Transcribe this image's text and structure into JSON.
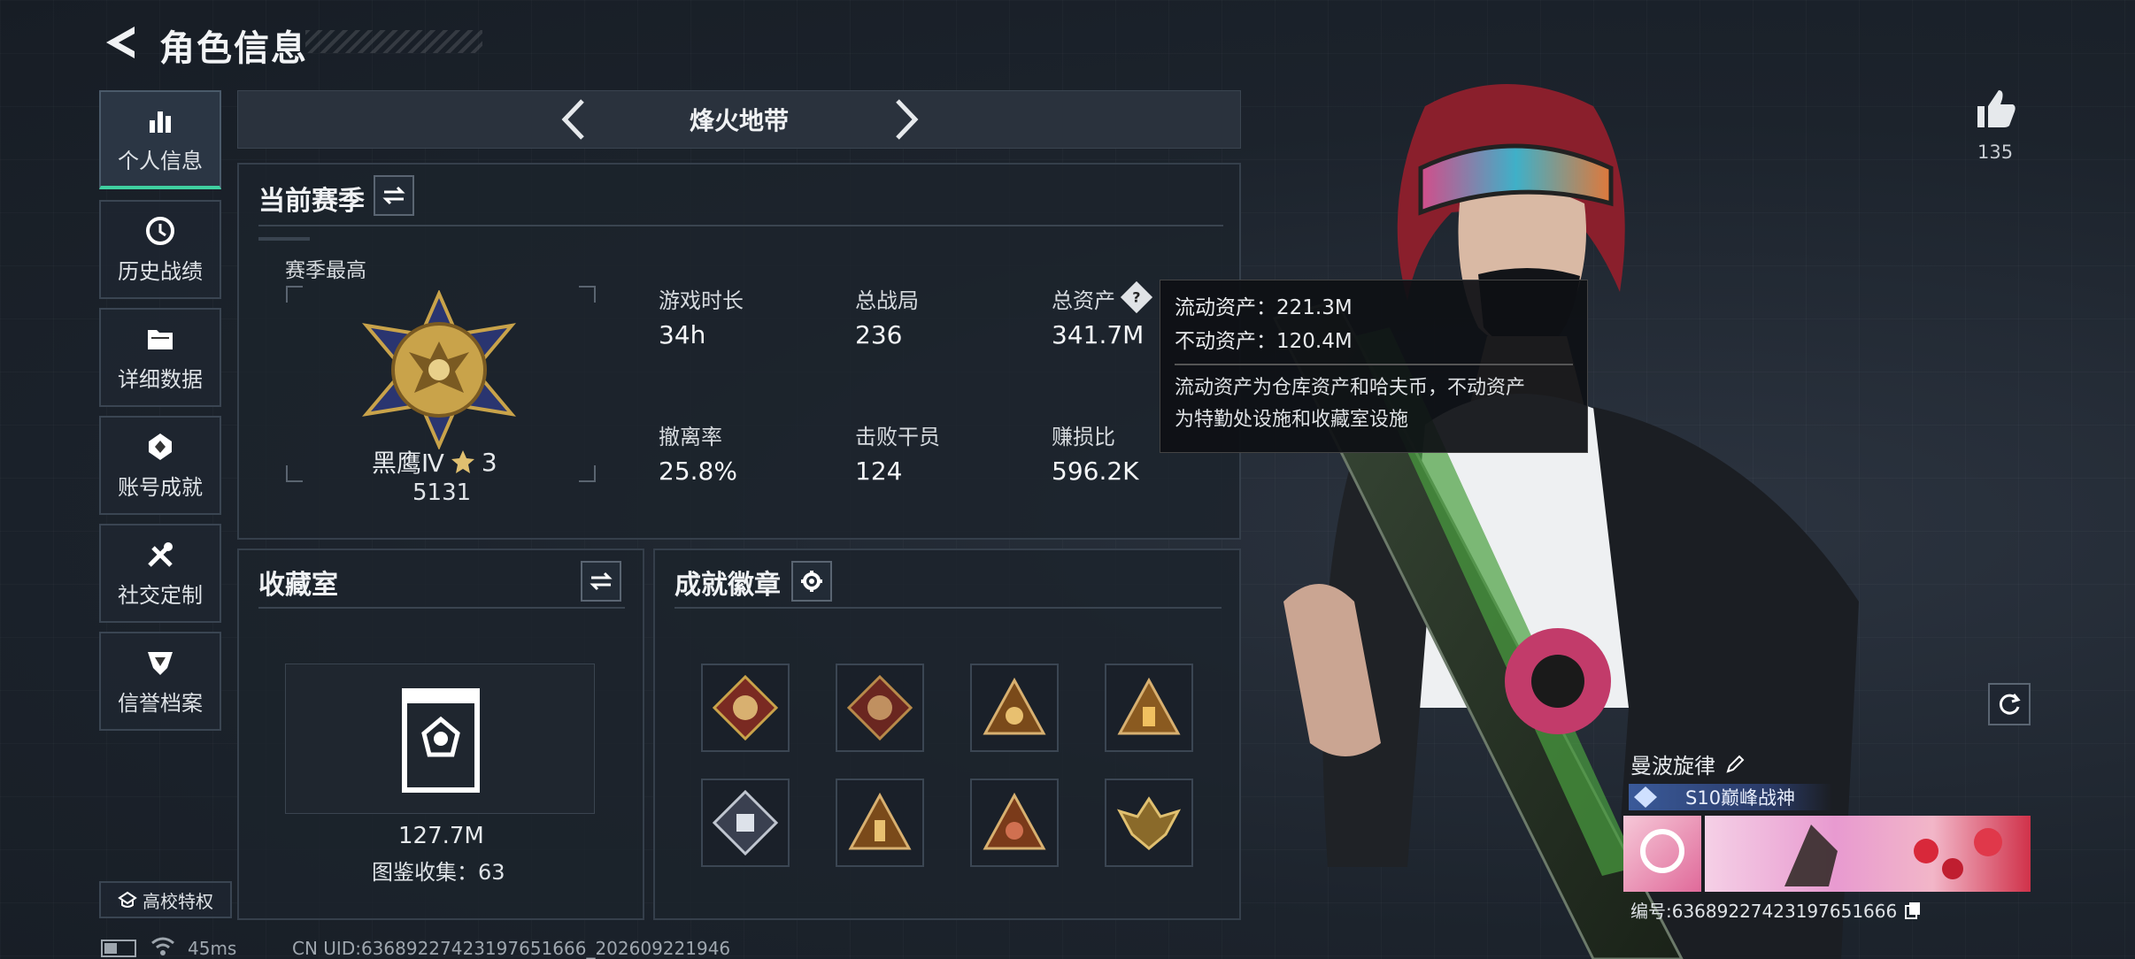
{
  "header": {
    "title": "角色信息"
  },
  "nav": [
    {
      "label": "个人信息",
      "icon": "bar-chart-icon",
      "active": true
    },
    {
      "label": "历史战绩",
      "icon": "clock-icon"
    },
    {
      "label": "详细数据",
      "icon": "folder-icon"
    },
    {
      "label": "账号成就",
      "icon": "achievement-icon"
    },
    {
      "label": "社交定制",
      "icon": "tools-icon"
    },
    {
      "label": "信誉档案",
      "icon": "shield-icon"
    }
  ],
  "campus": {
    "label": "高校特权"
  },
  "mode": {
    "label": "烽火地带"
  },
  "season": {
    "title": "当前赛季",
    "best_label": "赛季最高",
    "rank": "黑鹰Ⅳ",
    "stars": "3",
    "score": "5131",
    "stats": [
      {
        "label": "游戏时长",
        "value": "34h"
      },
      {
        "label": "总战局",
        "value": "236"
      },
      {
        "label": "总资产",
        "value": "341.7M"
      },
      {
        "label": "撤离率",
        "value": "25.8%"
      },
      {
        "label": "击败干员",
        "value": "124"
      },
      {
        "label": "赚损比",
        "value": "596.2K"
      }
    ]
  },
  "tooltip": {
    "liquid": "流动资产：221.3M",
    "fixed": "不动资产：120.4M",
    "desc1": "流动资产为仓库资产和哈夫币，不动资产",
    "desc2": "为特勤处设施和收藏室设施"
  },
  "collection": {
    "title": "收藏室",
    "value": "127.7M",
    "count_label": "图鉴收集：63"
  },
  "achievements": {
    "title": "成就徽章"
  },
  "likes": {
    "count": "135"
  },
  "player": {
    "name": "曼波旋律",
    "title_badge": "S10巅峰战神",
    "id_label": "编号:636892274231976516​66"
  },
  "status": {
    "ping": "45ms",
    "uid": "CN UID:6368922742319765166​6_202609221946"
  },
  "colors": {
    "accent": "#3fd0a0",
    "panel": "#1c232c",
    "gold": "#c9a34a"
  }
}
